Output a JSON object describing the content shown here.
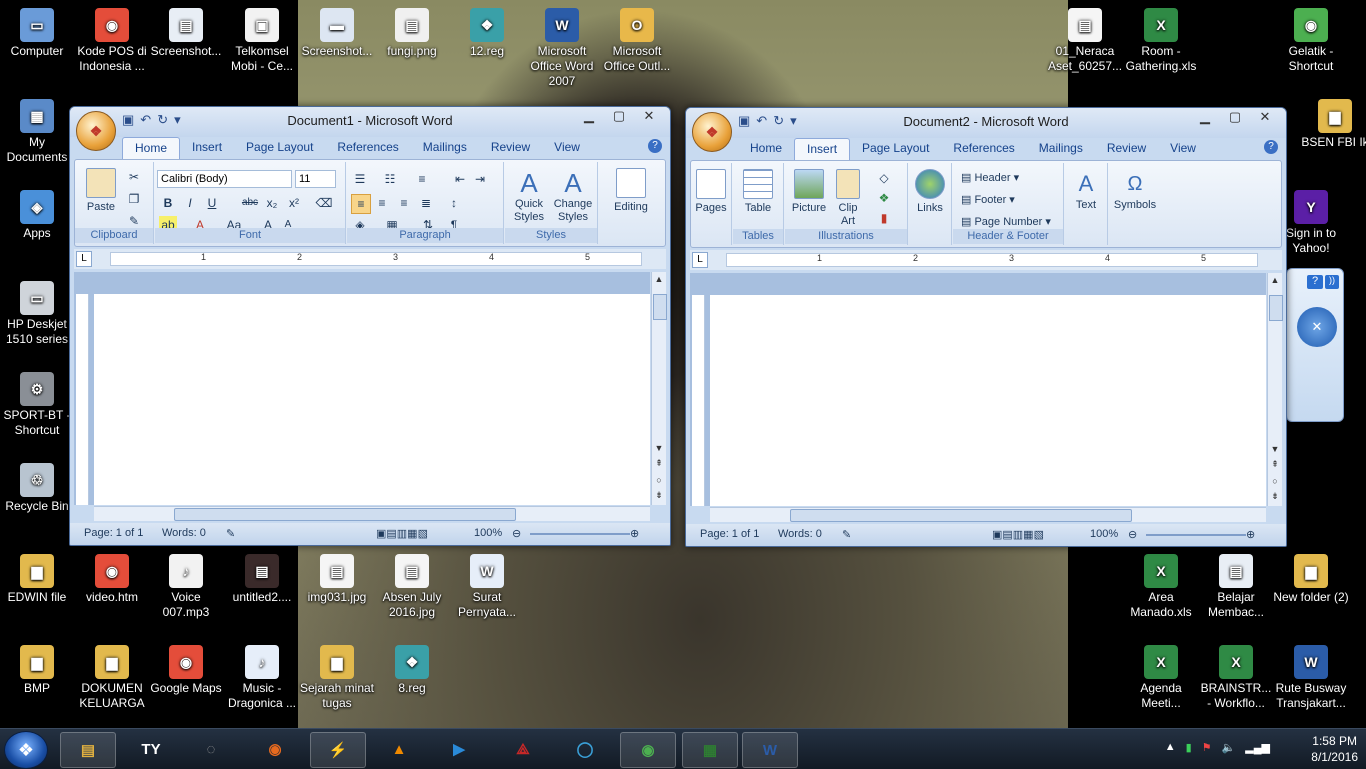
{
  "desktop_icons_left": [
    {
      "label": "Computer",
      "icon": "computer-icon",
      "color": "#6a9bd8",
      "glyph": "▭"
    },
    {
      "label": "Kode POS di Indonesia ...",
      "icon": "chrome-icon",
      "color": "#e44d3a",
      "glyph": "◉"
    },
    {
      "label": "Screenshot...",
      "icon": "image-icon",
      "color": "#e8eef5",
      "glyph": "▤"
    },
    {
      "label": "Telkomsel Mobi - Ce...",
      "icon": "shortcut-icon",
      "color": "#f2f2f2",
      "glyph": "▣"
    },
    {
      "label": "Screenshot...",
      "icon": "image-icon",
      "color": "#dde6f2",
      "glyph": "▬"
    },
    {
      "label": "fungi.png",
      "icon": "image-icon",
      "color": "#f0f0f0",
      "glyph": "▤"
    },
    {
      "label": "12.reg",
      "icon": "registry-icon",
      "color": "#3aa0a8",
      "glyph": "❖"
    },
    {
      "label": "Microsoft Office Word 2007",
      "icon": "word-icon",
      "color": "#2b5ca8",
      "glyph": "W"
    },
    {
      "label": "Microsoft Office Outl...",
      "icon": "outlook-icon",
      "color": "#e8b84a",
      "glyph": "O"
    }
  ],
  "desktop_icons_col1": [
    {
      "label": "My Documents",
      "icon": "documents-icon",
      "color": "#5a8ac8",
      "glyph": "▦"
    },
    {
      "label": "Apps",
      "icon": "apps-icon",
      "color": "#4a90d9",
      "glyph": "◈"
    },
    {
      "label": "HP Deskjet 1510 series",
      "icon": "printer-icon",
      "color": "#cfd4da",
      "glyph": "▭"
    },
    {
      "label": "SPORT-BT - Shortcut",
      "icon": "bluetooth-icon",
      "color": "#8a8f96",
      "glyph": "⚙"
    },
    {
      "label": "Recycle Bin",
      "icon": "recycle-bin-icon",
      "color": "#b8c4d0",
      "glyph": "♲"
    }
  ],
  "desktop_icons_right": [
    {
      "label": "01_Neraca Aset_60257...",
      "icon": "document-icon",
      "color": "#f5f5f5",
      "glyph": "▤"
    },
    {
      "label": "Room - Gathering.xls",
      "icon": "excel-icon",
      "color": "#2f8a45",
      "glyph": "X"
    },
    {
      "label": "Gelatik - Shortcut",
      "icon": "chrome-icon",
      "color": "#4caf50",
      "glyph": "◉"
    },
    {
      "label": "BSEN FBI Ik",
      "icon": "folder-icon",
      "color": "#e2b94d",
      "glyph": "▆"
    },
    {
      "label": "Sign in to Yahoo!",
      "icon": "yahoo-icon",
      "color": "#5b1fa6",
      "glyph": "Y"
    }
  ],
  "desktop_icons_row1": [
    {
      "label": "EDWIN file",
      "icon": "folder-icon",
      "color": "#e2b94d",
      "glyph": "▆"
    },
    {
      "label": "video.htm",
      "icon": "chrome-icon",
      "color": "#e44d3a",
      "glyph": "◉"
    },
    {
      "label": "Voice 007.mp3",
      "icon": "audio-icon",
      "color": "#f2f2f2",
      "glyph": "♪"
    },
    {
      "label": "untitled2....",
      "icon": "image-icon",
      "color": "#3a2a2a",
      "glyph": "▤"
    },
    {
      "label": "img031.jpg",
      "icon": "image-icon",
      "color": "#f5f5f5",
      "glyph": "▤"
    },
    {
      "label": "Absen July 2016.jpg",
      "icon": "image-icon",
      "color": "#f5f5f5",
      "glyph": "▤"
    },
    {
      "label": "Surat Pernyata...",
      "icon": "word-doc-icon",
      "color": "#e6eef9",
      "glyph": "W"
    }
  ],
  "desktop_icons_row2": [
    {
      "label": "BMP",
      "icon": "folder-icon",
      "color": "#e2b94d",
      "glyph": "▆"
    },
    {
      "label": "DOKUMEN KELUARGA",
      "icon": "folder-icon",
      "color": "#e2b94d",
      "glyph": "▆"
    },
    {
      "label": "Google Maps",
      "icon": "chrome-icon",
      "color": "#e44d3a",
      "glyph": "◉"
    },
    {
      "label": "Music - Dragonica ...",
      "icon": "audio-icon",
      "color": "#e6eef9",
      "glyph": "♪"
    },
    {
      "label": "Sejarah minat tugas",
      "icon": "folder-icon",
      "color": "#e2b94d",
      "glyph": "▆"
    },
    {
      "label": "8.reg",
      "icon": "registry-icon",
      "color": "#3aa0a8",
      "glyph": "❖"
    }
  ],
  "desktop_icons_right_bottom": [
    {
      "label": "Area Manado.xls",
      "icon": "excel-icon",
      "color": "#2f8a45",
      "glyph": "X"
    },
    {
      "label": "Belajar Membac...",
      "icon": "image-icon",
      "color": "#e8eef5",
      "glyph": "▤"
    },
    {
      "label": "New folder (2)",
      "icon": "folder-icon",
      "color": "#e2b94d",
      "glyph": "▆"
    },
    {
      "label": "Agenda Meeti...",
      "icon": "excel-icon",
      "color": "#2f8a45",
      "glyph": "X"
    },
    {
      "label": "BRAINSTR... - Workflo...",
      "icon": "excel-icon",
      "color": "#2f8a45",
      "glyph": "X"
    },
    {
      "label": "Rute Busway Transjakart...",
      "icon": "word-doc-icon",
      "color": "#2b5ca8",
      "glyph": "W"
    }
  ],
  "window1": {
    "title": "Document1 - Microsoft Word",
    "tabs": [
      "Home",
      "Insert",
      "Page Layout",
      "References",
      "Mailings",
      "Review",
      "View"
    ],
    "active_tab": "Home",
    "font_name": "Calibri (Body)",
    "font_size": "11",
    "paste": "Paste",
    "quick_styles": "Quick Styles",
    "change_styles": "Change Styles",
    "editing": "Editing",
    "groups": {
      "clipboard": "Clipboard",
      "font": "Font",
      "paragraph": "Paragraph",
      "styles": "Styles"
    },
    "status_page": "Page: 1 of 1",
    "status_words": "Words: 0",
    "zoom": "100%",
    "ruler_nums": [
      "1",
      "1",
      "2",
      "3",
      "4",
      "5"
    ]
  },
  "window2": {
    "title": "Document2 - Microsoft Word",
    "tabs": [
      "Home",
      "Insert",
      "Page Layout",
      "References",
      "Mailings",
      "Review",
      "View"
    ],
    "active_tab": "Insert",
    "pages": "Pages",
    "table": "Table",
    "picture": "Picture",
    "clip_art": "Clip Art",
    "links": "Links",
    "header": "Header",
    "footer": "Footer",
    "page_number": "Page Number",
    "text": "Text",
    "symbols": "Symbols",
    "groups": {
      "tables": "Tables",
      "illustrations": "Illustrations",
      "header_footer": "Header & Footer"
    },
    "status_page": "Page: 1 of 1",
    "status_words": "Words: 0",
    "zoom": "100%",
    "ruler_nums": [
      "1",
      "1",
      "2",
      "3",
      "4",
      "5"
    ]
  },
  "taskbar": {
    "time": "1:58 PM",
    "date": "8/1/2016",
    "items": [
      {
        "icon": "explorer-icon",
        "glyph": "▤",
        "color": "#e0b040"
      },
      {
        "icon": "ty-app-icon",
        "glyph": "TY",
        "color": "#222222"
      },
      {
        "icon": "disk-icon",
        "glyph": "◌",
        "color": "#9a9a9a"
      },
      {
        "icon": "firefox-icon",
        "glyph": "◉",
        "color": "#e66a1f"
      },
      {
        "icon": "winamp-icon",
        "glyph": "⚡",
        "color": "#d8a020"
      },
      {
        "icon": "vlc-icon",
        "glyph": "▲",
        "color": "#f08a00"
      },
      {
        "icon": "media-player-icon",
        "glyph": "▶",
        "color": "#2a8ad8"
      },
      {
        "icon": "acrobat-icon",
        "glyph": "⟁",
        "color": "#c62828"
      },
      {
        "icon": "chat-icon",
        "glyph": "◯",
        "color": "#3aa0d8"
      },
      {
        "icon": "chrome-icon",
        "glyph": "◉",
        "color": "#4caf50"
      },
      {
        "icon": "task-manager-icon",
        "glyph": "▦",
        "color": "#2e7d32"
      },
      {
        "icon": "word-icon",
        "glyph": "W",
        "color": "#2b5ca8"
      }
    ]
  }
}
